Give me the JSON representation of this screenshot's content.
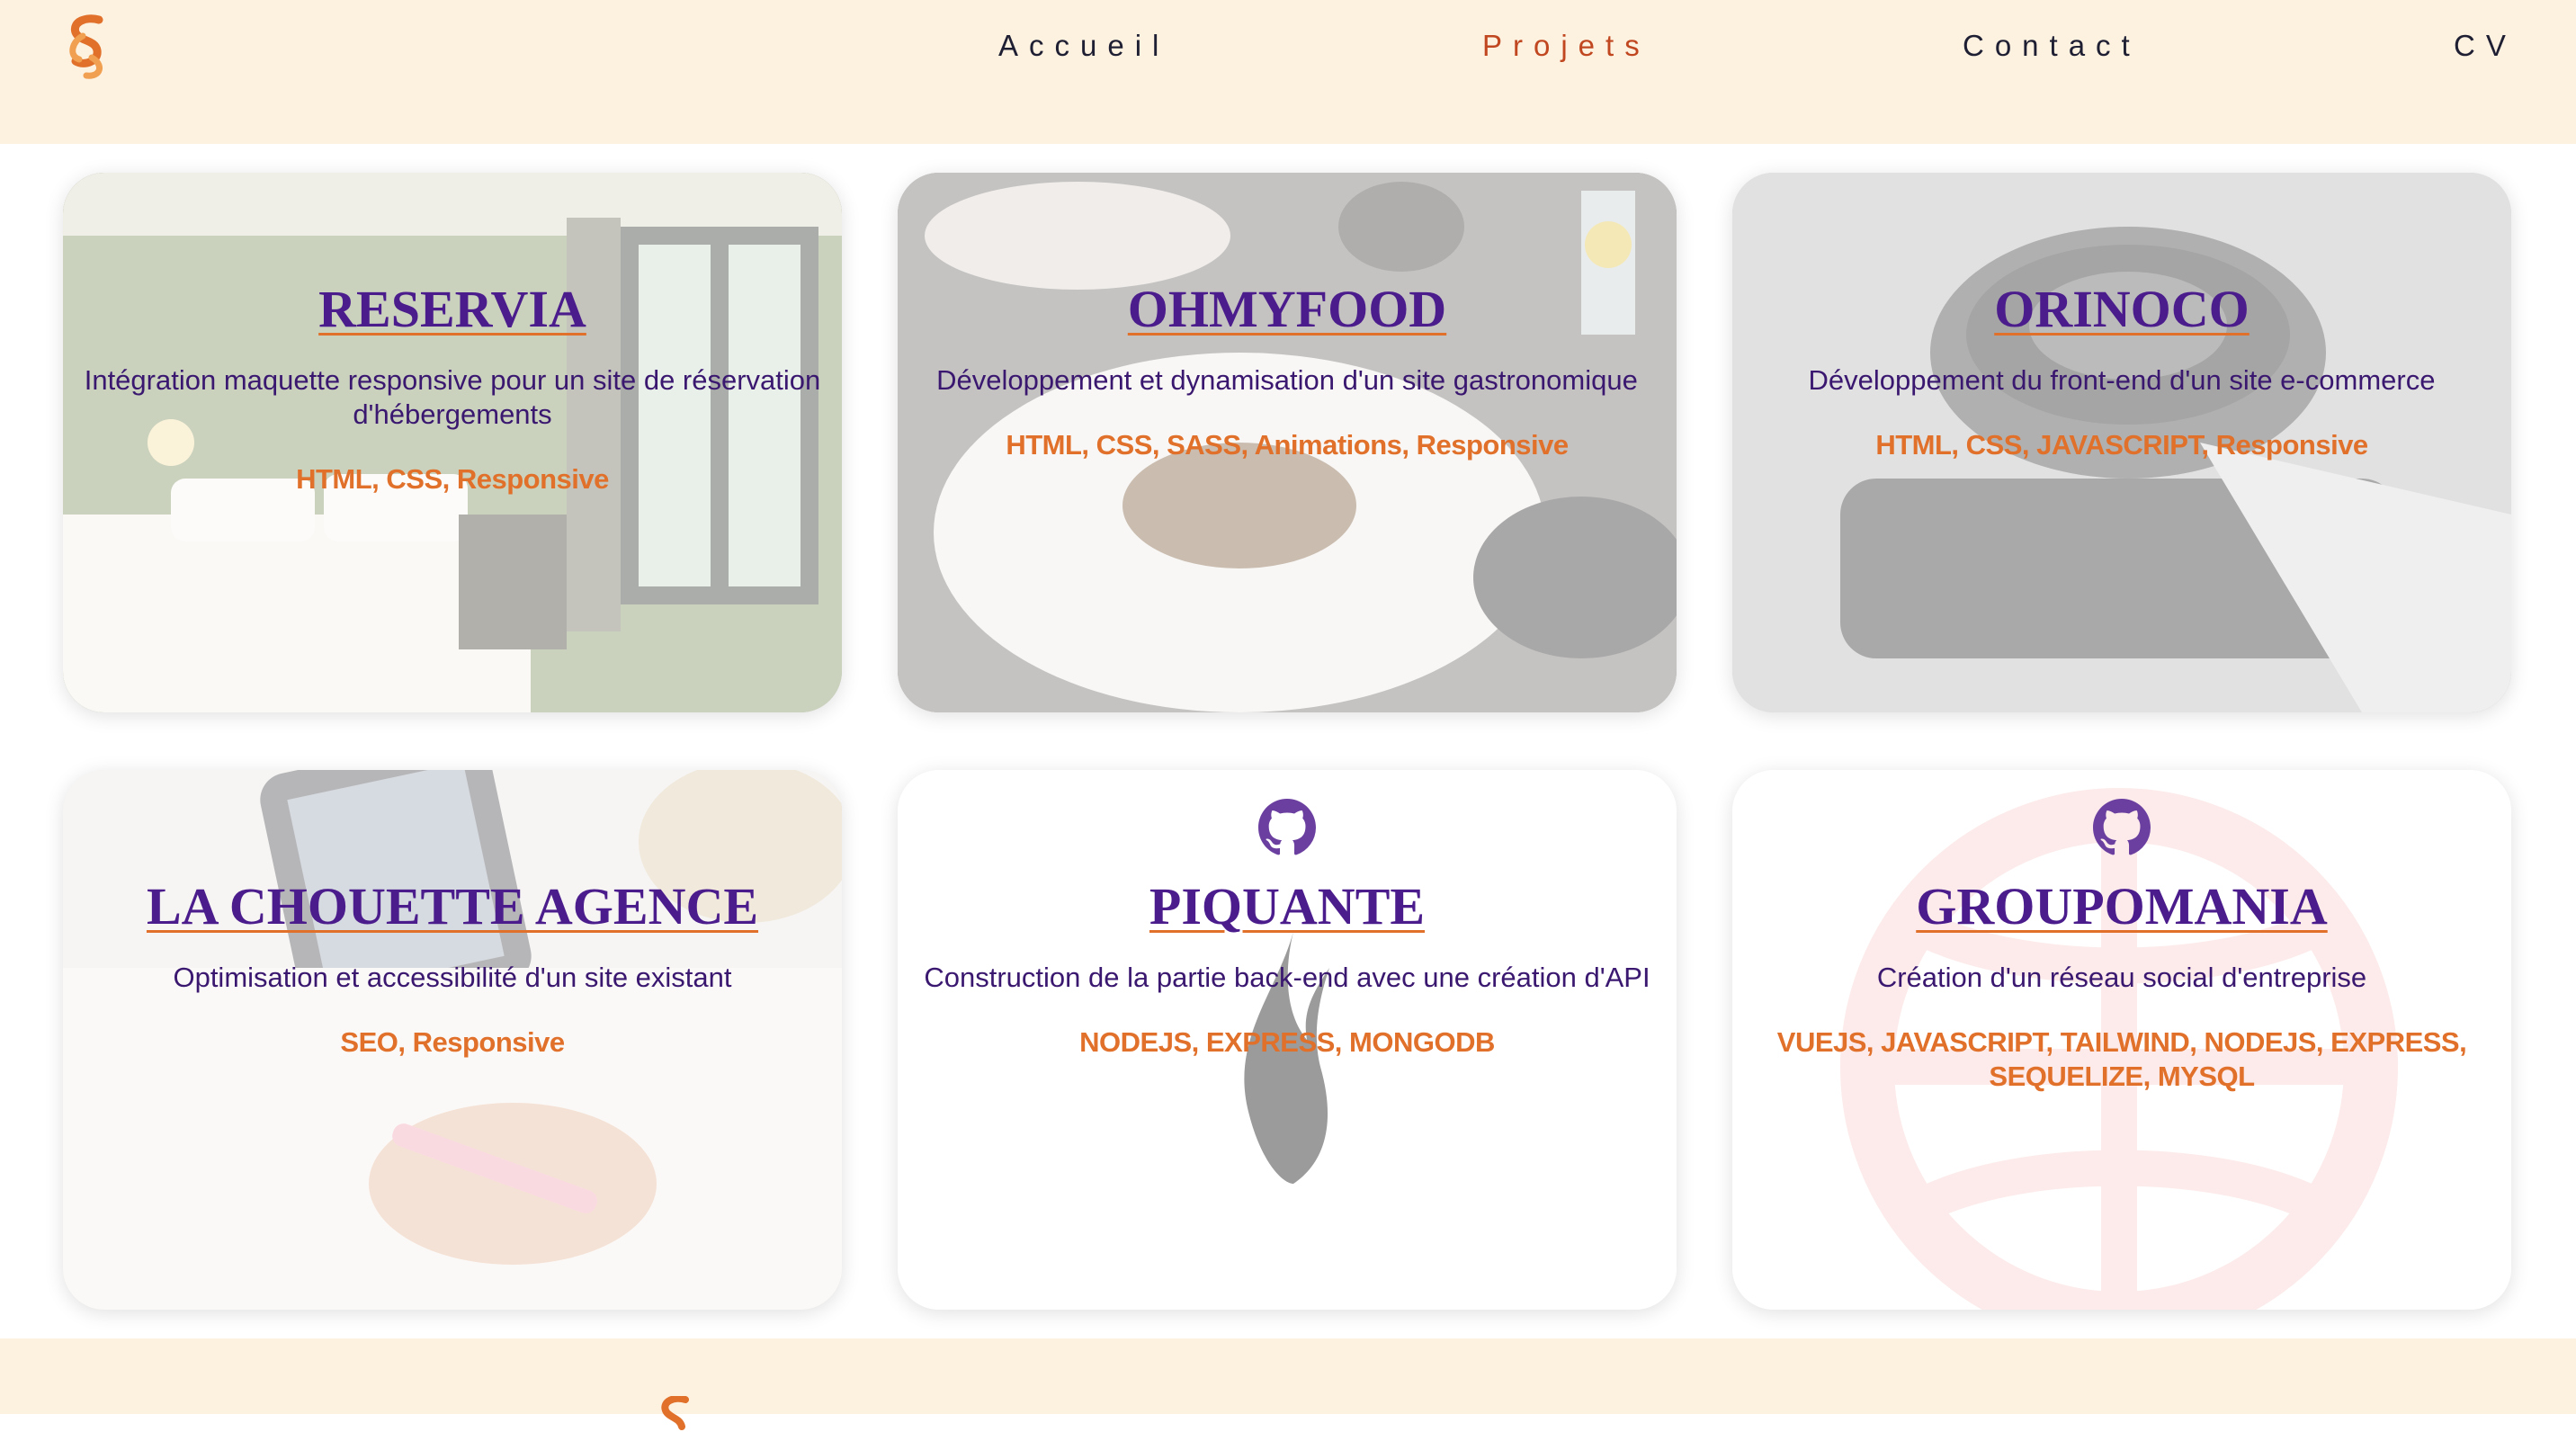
{
  "header": {
    "logo_icon": "ss-monogram-logo",
    "nav": [
      {
        "label": "Accueil",
        "active": false
      },
      {
        "label": "Projets",
        "active": true
      },
      {
        "label": "Contact",
        "active": false
      },
      {
        "label": "CV",
        "active": false
      }
    ]
  },
  "colors": {
    "header_bg": "#fdf1e0",
    "title": "#4b1c8c",
    "description": "#3a1870",
    "tags": "#e0702a",
    "nav_active": "#c0471f",
    "nav": "#1f1f33"
  },
  "projects": [
    {
      "title": "RESERVIA",
      "description": "Intégration maquette responsive pour un site de réservation d'hébergements",
      "tags": "HTML, CSS, Responsive",
      "background": "hotel-room-photo"
    },
    {
      "title": "OHMYFOOD",
      "description": "Développement et dynamisation d'un site gastronomique",
      "tags": "HTML, CSS, SASS, Animations, Responsive",
      "background": "food-plate-photo"
    },
    {
      "title": "ORINOCO",
      "description": "Développement du front-end d'un site e-commerce",
      "tags": "HTML, CSS, JAVASCRIPT, Responsive",
      "background": "camera-lens-photo"
    },
    {
      "title": "LA CHOUETTE AGENCE",
      "description": "Optimisation et accessibilité d'un site existant",
      "tags": "SEO, Responsive",
      "background": "phone-sketch-photo"
    },
    {
      "title": "PIQUANTE",
      "description": "Construction de la partie back-end avec une création d'API",
      "tags": "NODEJS, EXPRESS, MONGODB",
      "background": "pepper-flame-logo",
      "icon": "github-icon"
    },
    {
      "title": "GROUPOMANIA",
      "description": "Création d'un réseau social d'entreprise",
      "tags": "VUEJS, JAVASCRIPT, TAILWIND, NODEJS, EXPRESS, SEQUELIZE, MYSQL",
      "background": "globe-logo",
      "icon": "github-icon"
    }
  ],
  "footer": {
    "logo_icon": "ss-monogram-logo"
  }
}
